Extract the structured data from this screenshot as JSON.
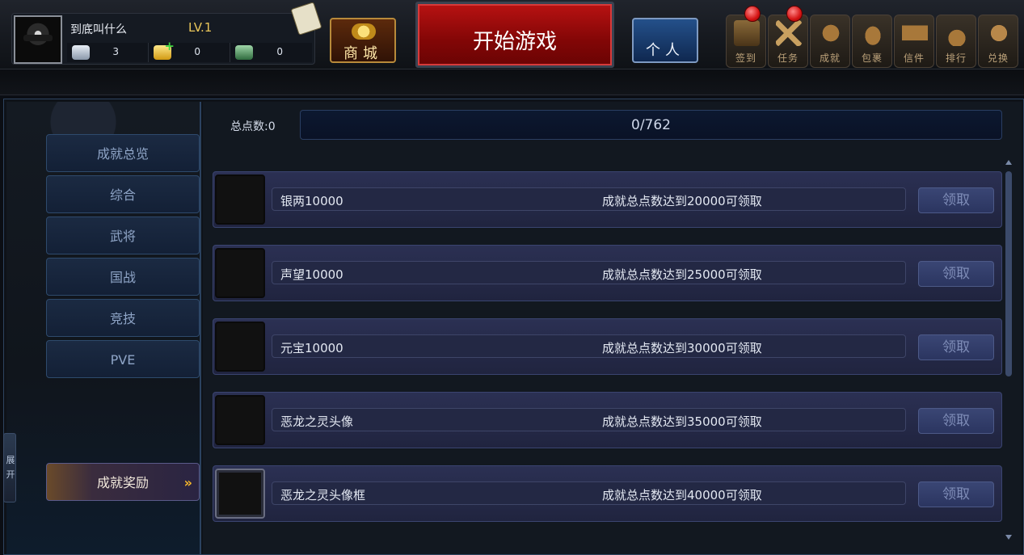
{
  "header": {
    "player_name": "到底叫什么",
    "level": "LV.1",
    "resources": [
      {
        "name": "silver-icon",
        "value": "3"
      },
      {
        "name": "gold-ingot-icon",
        "value": "0"
      },
      {
        "name": "jade-seal-icon",
        "value": "0"
      }
    ],
    "shop_label": "商城",
    "start_label": "开始游戏",
    "personal_label": "个人",
    "quick_buttons": [
      {
        "label": "签到",
        "badge": true
      },
      {
        "label": "任务",
        "badge": true
      },
      {
        "label": "成就",
        "badge": false
      },
      {
        "label": "包裹",
        "badge": false
      },
      {
        "label": "信件",
        "badge": false
      },
      {
        "label": "排行",
        "badge": false
      },
      {
        "label": "兑换",
        "badge": false
      }
    ]
  },
  "sidebar": {
    "items": [
      {
        "label": "成就总览"
      },
      {
        "label": "综合"
      },
      {
        "label": "武将"
      },
      {
        "label": "国战"
      },
      {
        "label": "竞技"
      },
      {
        "label": "PVE"
      }
    ],
    "active_item": {
      "label": "成就奖励",
      "arrow": "»"
    },
    "expand_tab": [
      "展",
      "开"
    ]
  },
  "main": {
    "total_label": "总点数:0",
    "progress_text": "0/762",
    "progress_fraction": 0,
    "rewards": [
      {
        "name": "银两10000",
        "condition": "成就总点数达到20000可领取",
        "button": "领取",
        "icon": "silver-reward-icon"
      },
      {
        "name": "声望10000",
        "condition": "成就总点数达到25000可领取",
        "button": "领取",
        "icon": "jade-seal-reward-icon"
      },
      {
        "name": "元宝10000",
        "condition": "成就总点数达到30000可领取",
        "button": "领取",
        "icon": "gold-ingot-reward-icon"
      },
      {
        "name": "恶龙之灵头像",
        "condition": "成就总点数达到35000可领取",
        "button": "领取",
        "icon": "dragon-avatar-icon"
      },
      {
        "name": "恶龙之灵头像框",
        "condition": "成就总点数达到40000可领取",
        "button": "领取",
        "icon": "dragon-frame-icon"
      }
    ]
  }
}
